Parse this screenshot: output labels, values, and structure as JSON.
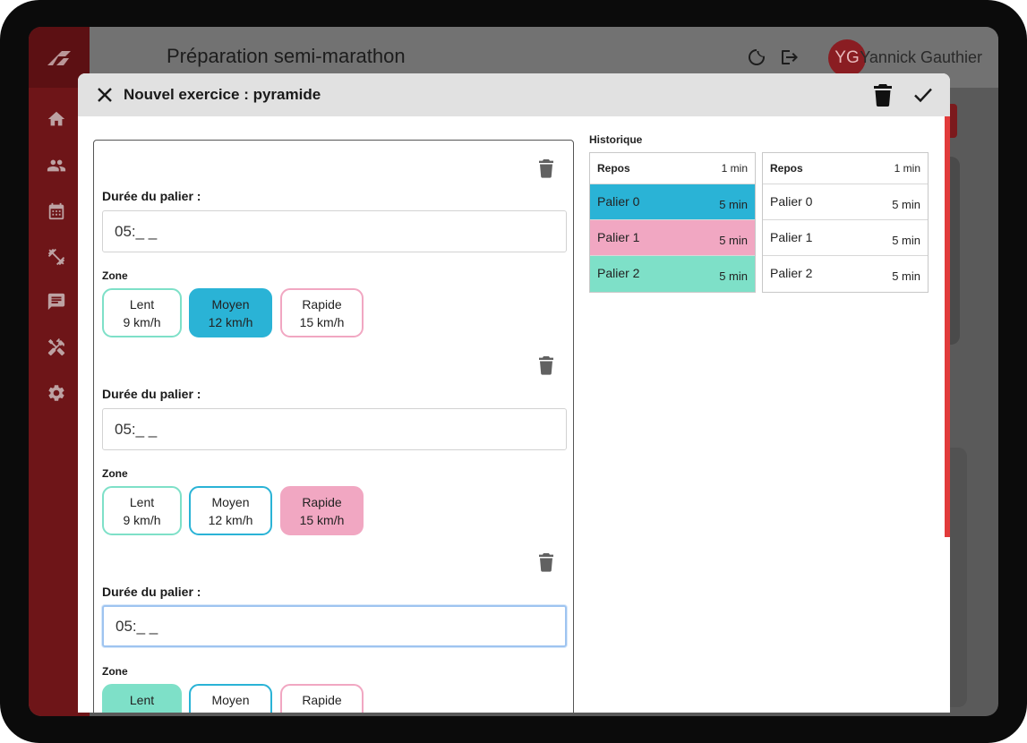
{
  "app": {
    "title": "Préparation semi-marathon",
    "user_initials": "YG",
    "user_name": "Yannick Gauthier",
    "icons": [
      "home-icon",
      "people-icon",
      "calendar-icon",
      "dumbbell-icon",
      "chat-icon",
      "tools-icon",
      "gear-icon",
      "moon-icon",
      "logout-icon"
    ]
  },
  "modal": {
    "title": "Nouvel exercice : pyramide",
    "levels": [
      {
        "label": "Durée du palier :",
        "value": "05:_ _",
        "zone_label": "Zone",
        "selected_zone": "Moyen"
      },
      {
        "label": "Durée du palier :",
        "value": "05:_ _",
        "zone_label": "Zone",
        "selected_zone": "Rapide"
      },
      {
        "label": "Durée du palier :",
        "value": "05:_ _",
        "zone_label": "Zone",
        "selected_zone": "Lent"
      }
    ],
    "zones": [
      {
        "name": "Lent",
        "speed": "9 km/h",
        "color": "#7ee0c8"
      },
      {
        "name": "Moyen",
        "speed": "12 km/h",
        "color": "#2ab3d6"
      },
      {
        "name": "Rapide",
        "speed": "15 km/h",
        "color": "#f1a7c2"
      }
    ]
  },
  "historique": {
    "title": "Historique",
    "tables": [
      {
        "colored": true,
        "rows": [
          {
            "name": "Repos",
            "duration": "1 min"
          },
          {
            "name": "Palier 0",
            "duration": "5 min",
            "color": "#2ab3d6"
          },
          {
            "name": "Palier 1",
            "duration": "5 min",
            "color": "#f1a7c2"
          },
          {
            "name": "Palier 2",
            "duration": "5 min",
            "color": "#7ee0c8"
          }
        ]
      },
      {
        "colored": false,
        "rows": [
          {
            "name": "Repos",
            "duration": "1 min"
          },
          {
            "name": "Palier 0",
            "duration": "5 min"
          },
          {
            "name": "Palier 1",
            "duration": "5 min"
          },
          {
            "name": "Palier 2",
            "duration": "5 min"
          }
        ]
      }
    ]
  }
}
